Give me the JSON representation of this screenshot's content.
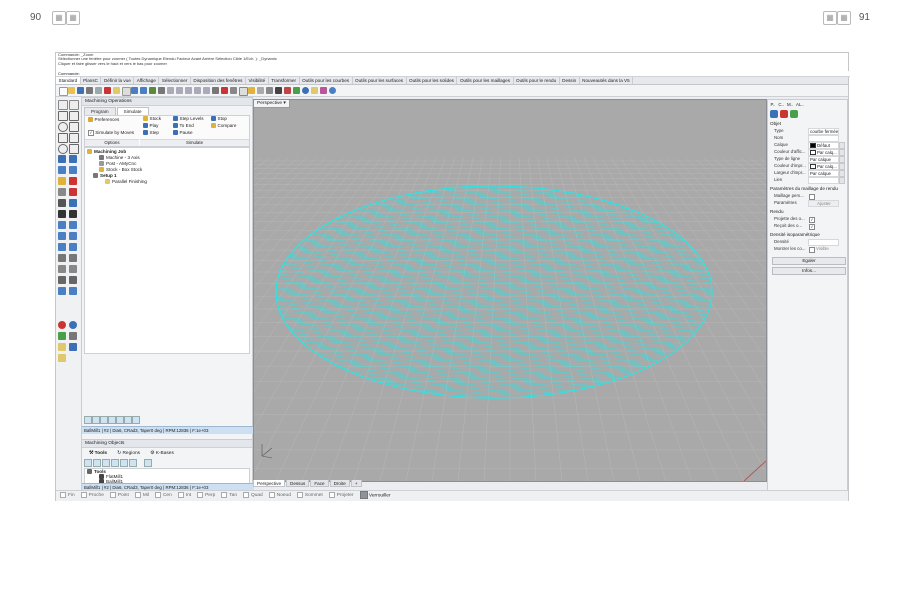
{
  "page": {
    "left_number": "90",
    "right_number": "91"
  },
  "command": {
    "history": [
      "Commande: _Zoom",
      "Sélectionner une fenêtre pour zoomer ( Toutes Dynamique Etendu Facteur Avant Arrière Sélection Cible 1/Ech. ): _Dynamic",
      "Cliquer et faire glisser vers le haut et vers le bas pour zoomer"
    ],
    "prompt": "Commande:"
  },
  "toolbar_tabs": [
    "Standard",
    "PlansC",
    "Définir la vue",
    "Affichage",
    "Sélectionner",
    "Disposition des fenêtres",
    "Visibilité",
    "Transformer",
    "Outils pour les courbes",
    "Outils pour les surfaces",
    "Outils pour les solides",
    "Outils pour les maillages",
    "Outils pour le rendu",
    "Dessin",
    "Nouveautés dans la V5"
  ],
  "machining_ops": {
    "title": "Machining Operations",
    "subtabs": [
      "Program",
      "Simulate"
    ],
    "ribbon": {
      "preferences": "Preferences",
      "simulate_by_moves": "Simulate by Moves",
      "stock": "Stock",
      "play": "Play",
      "step": "Step",
      "step_levels": "Step Levels",
      "to_end": "To End",
      "pause": "Pause",
      "stop": "Stop",
      "compare": "Compare",
      "group_options": "Options",
      "group_simulate": "Simulate"
    },
    "tree": {
      "job": "Machining Job",
      "machine": "Machine - 3 Axis",
      "post": "Post - AMyCnc",
      "stock": "Stock - Box Stock",
      "setup": "Setup 1",
      "op": "Parallel Finishing"
    },
    "status": "BallMill1 | #2 | Dia6, CRad3, Taper0 deg | RPM:12836 | F:1e+03"
  },
  "machining_objects": {
    "title": "Machining Objects",
    "tabs": [
      "Tools",
      "Regions",
      "K-Bases"
    ],
    "tree": {
      "tools": "Tools",
      "flat": "FlatMill1",
      "ball": "BallMill1"
    },
    "status": "BallMill1 | #2 | Dia6, CRad3, Taper0 deg | RPM:12836 | F:1e+03"
  },
  "viewport": {
    "name": "Perspective",
    "tabs": [
      "Perspective",
      "Dessus",
      "Face",
      "Droite"
    ],
    "add_tab": "+"
  },
  "properties": {
    "tabs": [
      "P..",
      "C..",
      "M..",
      "AL.."
    ],
    "section_object": "Objet",
    "rows": [
      {
        "k": "Type",
        "v": "courbe fermée"
      },
      {
        "k": "Nom",
        "v": ""
      },
      {
        "k": "Calque",
        "v": "Défaut"
      },
      {
        "k": "Couleur d'affic...",
        "v": "Par calq..."
      },
      {
        "k": "Type de ligne",
        "v": "Par calque"
      },
      {
        "k": "Couleur d'impr...",
        "v": "Par calq..."
      },
      {
        "k": "Largeur d'impr...",
        "v": "Par calque"
      },
      {
        "k": "Lien",
        "v": ""
      }
    ],
    "section_mesh": "Paramètres du maillage de rendu",
    "mesh_rows": [
      {
        "k": "Maillage pers...",
        "v": ""
      },
      {
        "k": "Paramètres",
        "v": "Ajuster"
      }
    ],
    "section_render": "Rendu",
    "render_rows": [
      {
        "k": "Projette des o...",
        "v": ""
      },
      {
        "k": "Reçoit des o...",
        "v": ""
      }
    ],
    "section_iso": "Densité isoparamétrique",
    "iso_rows": [
      {
        "k": "Densité",
        "v": ""
      },
      {
        "k": "Montrer les co...",
        "v": "Visible"
      }
    ],
    "btn_match": "Egaler",
    "btn_info": "Infos..."
  },
  "osnaps": [
    "Fin",
    "Proche",
    "Point",
    "Mil",
    "Cen",
    "Int",
    "Perp",
    "Tan",
    "Quad",
    "Noeud",
    "Sommet",
    "Projeter"
  ],
  "lock_label": "Verrouiller",
  "colors": {
    "toolpath": "#2ee3e3",
    "viewport_bg": "#a9a9a9",
    "selection_blue": "#cde0f3"
  }
}
